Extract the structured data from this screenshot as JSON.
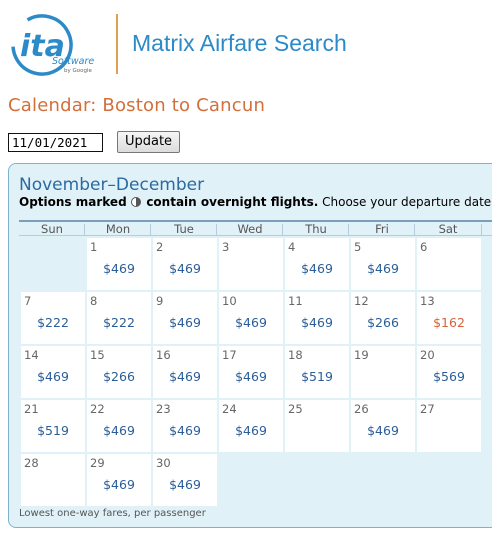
{
  "header": {
    "logo_text": "ita",
    "logo_subtext": "Software",
    "logo_byline": "by Google",
    "app_title": "Matrix Airfare Search"
  },
  "page_heading": "Calendar: Boston to Cancun",
  "controls": {
    "date_value": "11/01/2021",
    "update_label": "Update"
  },
  "calendar": {
    "month_range": "November–December",
    "note_bold": "Options marked",
    "note_bold2": "contain overnight flights.",
    "note_rest": "Choose your departure date.",
    "weekdays": [
      "Sun",
      "Mon",
      "Tue",
      "Wed",
      "Thu",
      "Fri",
      "Sat"
    ],
    "weeks": [
      [
        {
          "day": "",
          "fare": ""
        },
        {
          "day": "1",
          "fare": "$469"
        },
        {
          "day": "2",
          "fare": "$469"
        },
        {
          "day": "3",
          "fare": ""
        },
        {
          "day": "4",
          "fare": "$469"
        },
        {
          "day": "5",
          "fare": "$469"
        },
        {
          "day": "6",
          "fare": ""
        }
      ],
      [
        {
          "day": "7",
          "fare": "$222"
        },
        {
          "day": "8",
          "fare": "$222"
        },
        {
          "day": "9",
          "fare": "$469"
        },
        {
          "day": "10",
          "fare": "$469"
        },
        {
          "day": "11",
          "fare": "$469"
        },
        {
          "day": "12",
          "fare": "$266"
        },
        {
          "day": "13",
          "fare": "$162",
          "lowest": true
        }
      ],
      [
        {
          "day": "14",
          "fare": "$469"
        },
        {
          "day": "15",
          "fare": "$266"
        },
        {
          "day": "16",
          "fare": "$469"
        },
        {
          "day": "17",
          "fare": "$469"
        },
        {
          "day": "18",
          "fare": "$519"
        },
        {
          "day": "19",
          "fare": ""
        },
        {
          "day": "20",
          "fare": "$569"
        }
      ],
      [
        {
          "day": "21",
          "fare": "$519"
        },
        {
          "day": "22",
          "fare": "$469"
        },
        {
          "day": "23",
          "fare": "$469"
        },
        {
          "day": "24",
          "fare": "$469"
        },
        {
          "day": "25",
          "fare": ""
        },
        {
          "day": "26",
          "fare": "$469"
        },
        {
          "day": "27",
          "fare": ""
        }
      ],
      [
        {
          "day": "28",
          "fare": ""
        },
        {
          "day": "29",
          "fare": "$469"
        },
        {
          "day": "30",
          "fare": "$469"
        }
      ]
    ],
    "footnote": "Lowest one-way fares, per passenger"
  },
  "colors": {
    "accent": "#2c8ac8",
    "heading": "#d26f3a",
    "fare": "#2b5d98",
    "lowest_fare": "#d6623a",
    "panel_bg": "#e1f1f8"
  }
}
